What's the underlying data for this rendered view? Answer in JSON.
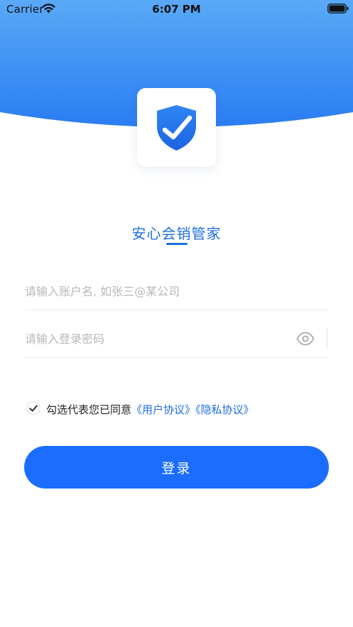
{
  "status_bar": {
    "carrier": "Carrier",
    "time": "6:07 PM"
  },
  "app": {
    "title": "安心会销管家",
    "logo_icon": "shield-check-icon"
  },
  "form": {
    "account_placeholder": "请输入账户名, 如张三@某公司",
    "account_value": "",
    "password_placeholder": "请输入登录密码",
    "password_value": "",
    "show_password_icon": "eye-icon"
  },
  "agreement": {
    "checked": true,
    "text": "勾选代表您已同意",
    "user_agreement": "《用户协议》",
    "privacy_policy": "《隐私协议》"
  },
  "login_button": {
    "label": "登录"
  },
  "colors": {
    "header_top": "#5aa9f7",
    "header_bottom": "#2a7df2",
    "accent": "#1d6fe0",
    "button": "#1a6dff",
    "placeholder": "#b8b8b8"
  }
}
